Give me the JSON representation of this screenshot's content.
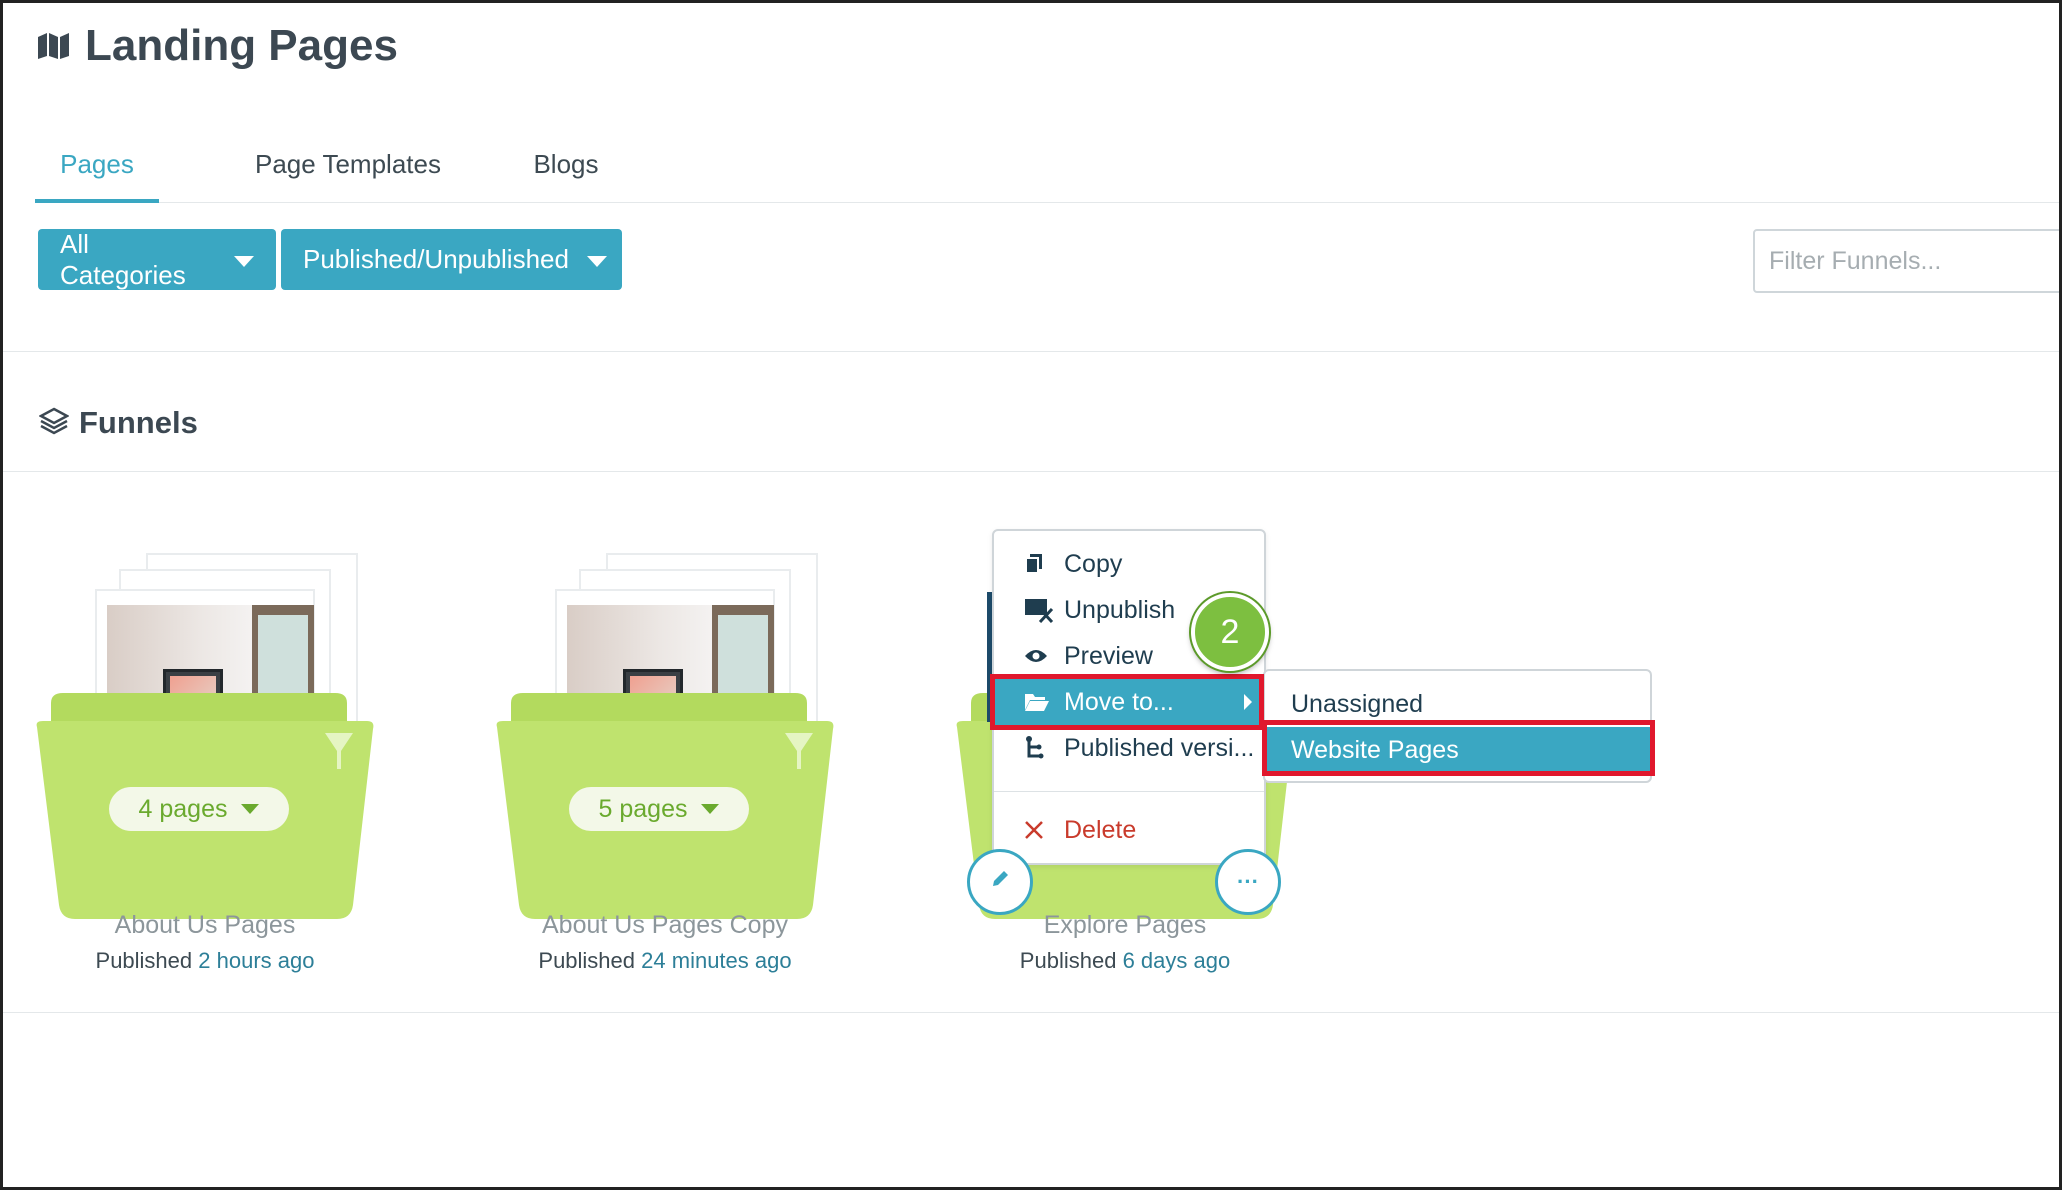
{
  "header": {
    "title": "Landing Pages",
    "icon": "map-icon"
  },
  "tabs": [
    {
      "label": "Pages",
      "active": true
    },
    {
      "label": "Page Templates",
      "active": false
    },
    {
      "label": "Blogs",
      "active": false
    }
  ],
  "filters": {
    "categories_label": "All Categories",
    "published_label": "Published/Unpublished",
    "search_placeholder": "Filter Funnels..."
  },
  "section": {
    "title": "Funnels",
    "icon": "layers-icon"
  },
  "funnels": [
    {
      "name": "About Us Pages",
      "pages": "4 pages",
      "status_prefix": "Published",
      "status_time": "2 hours ago"
    },
    {
      "name": "About Us Pages Copy",
      "pages": "5 pages",
      "status_prefix": "Published",
      "status_time": "24 minutes ago"
    },
    {
      "name": "Explore Pages",
      "status_prefix": "Published",
      "status_time": "6 days ago"
    }
  ],
  "card_actions": {
    "more_label": "···"
  },
  "context_menu": {
    "items": [
      {
        "label": "Copy",
        "icon": "copy-icon"
      },
      {
        "label": "Unpublish",
        "icon": "unpublish-icon"
      },
      {
        "label": "Preview",
        "icon": "eye-icon"
      },
      {
        "label": "Move to...",
        "icon": "folder-open-icon",
        "active": true
      },
      {
        "label": "Published versi...",
        "icon": "version-tree-icon"
      },
      {
        "label": "Delete",
        "icon": "close-icon"
      }
    ]
  },
  "submenu": {
    "items": [
      {
        "label": "Unassigned",
        "active": false
      },
      {
        "label": "Website Pages",
        "active": true
      }
    ]
  },
  "step_badge": "2",
  "colors": {
    "accent": "#3aa7c2",
    "folder_green": "#b9e06a",
    "highlight_red": "#e0182d",
    "badge_green": "#7dbf40",
    "danger": "#c93b2c"
  }
}
